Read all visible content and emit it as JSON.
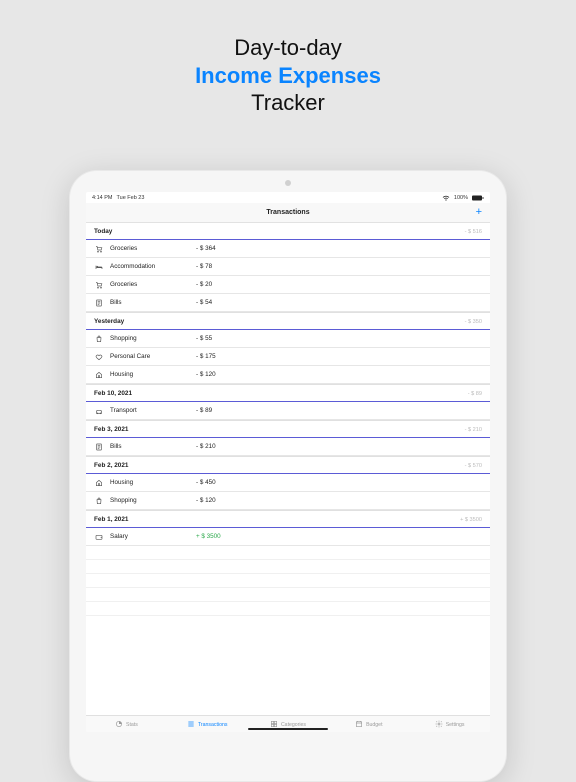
{
  "promo": {
    "line1": "Day-to-day",
    "line2": "Income Expenses",
    "line3": "Tracker"
  },
  "statusbar": {
    "time": "4:14 PM",
    "date": "Tue Feb 23",
    "charge": "100%"
  },
  "navbar": {
    "title": "Transactions",
    "add_glyph": "+"
  },
  "sections": [
    {
      "title": "Today",
      "total": "- $ 516",
      "rows": [
        {
          "icon": "cart",
          "label": "Groceries",
          "amount": "- $ 364"
        },
        {
          "icon": "bed",
          "label": "Accommodation",
          "amount": "- $ 78"
        },
        {
          "icon": "cart",
          "label": "Groceries",
          "amount": "- $ 20"
        },
        {
          "icon": "doc",
          "label": "Bills",
          "amount": "- $ 54"
        }
      ]
    },
    {
      "title": "Yesterday",
      "total": "- $ 350",
      "rows": [
        {
          "icon": "bag",
          "label": "Shopping",
          "amount": "- $ 55"
        },
        {
          "icon": "heart",
          "label": "Personal Care",
          "amount": "- $ 175"
        },
        {
          "icon": "house",
          "label": "Housing",
          "amount": "- $ 120"
        }
      ]
    },
    {
      "title": "Feb 10, 2021",
      "total": "- $ 89",
      "rows": [
        {
          "icon": "car",
          "label": "Transport",
          "amount": "- $ 89"
        }
      ]
    },
    {
      "title": "Feb 3, 2021",
      "total": "- $ 210",
      "rows": [
        {
          "icon": "doc",
          "label": "Bills",
          "amount": "- $ 210"
        }
      ]
    },
    {
      "title": "Feb 2, 2021",
      "total": "- $ 570",
      "rows": [
        {
          "icon": "house",
          "label": "Housing",
          "amount": "- $ 450"
        },
        {
          "icon": "bag",
          "label": "Shopping",
          "amount": "- $ 120"
        }
      ]
    },
    {
      "title": "Feb 1, 2021",
      "total": "+ $ 3500",
      "rows": [
        {
          "icon": "wallet",
          "label": "Salary",
          "amount": "+ $ 3500",
          "positive": true
        }
      ]
    }
  ],
  "tabs": [
    {
      "id": "stats",
      "label": "Stats"
    },
    {
      "id": "transactions",
      "label": "Transactions",
      "active": true
    },
    {
      "id": "categories",
      "label": "Categories"
    },
    {
      "id": "budget",
      "label": "Budget"
    },
    {
      "id": "settings",
      "label": "Settings"
    }
  ]
}
